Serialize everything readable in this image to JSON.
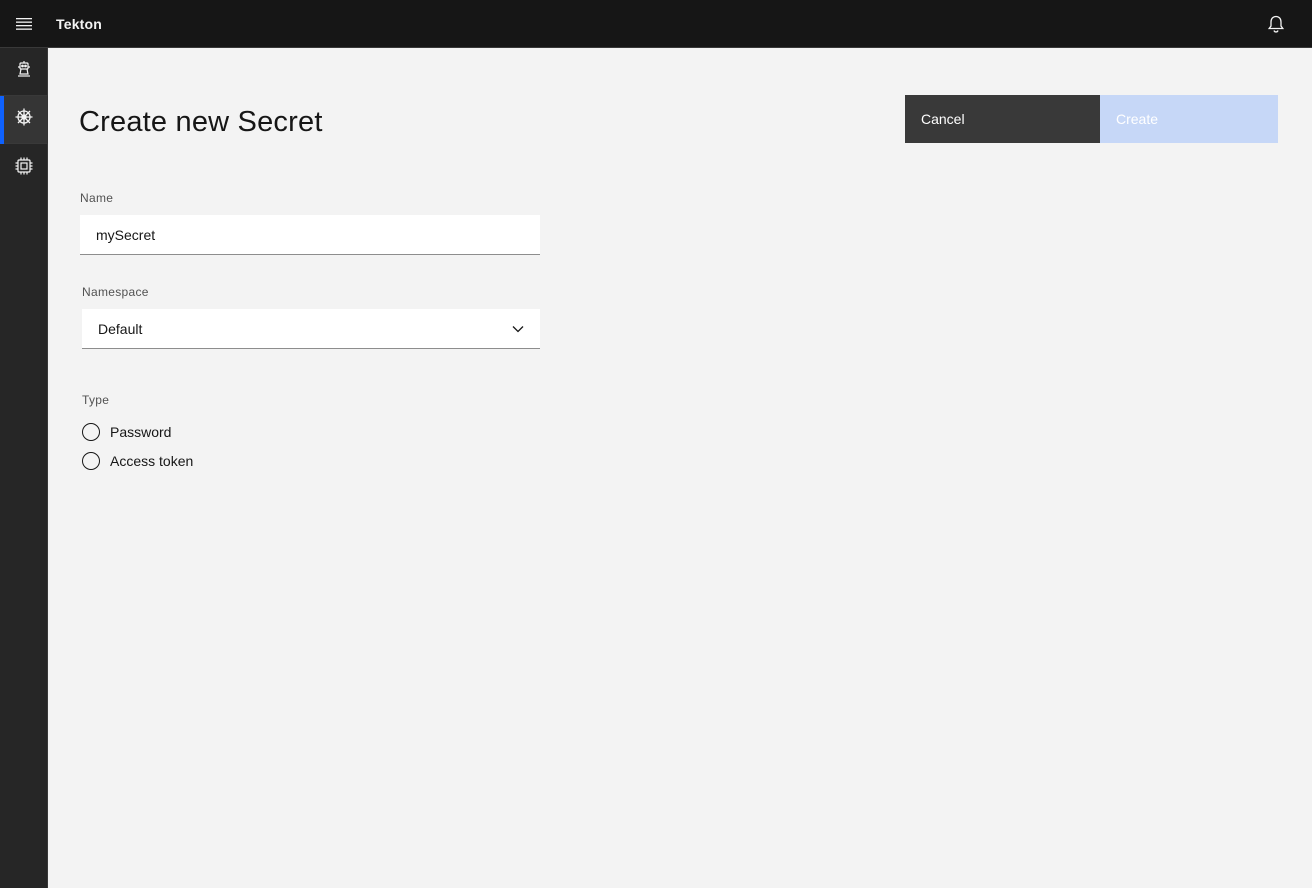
{
  "header": {
    "app_title": "Tekton",
    "menu_icon": "hamburger-menu-icon",
    "notification_icon": "bell-icon"
  },
  "sidenav": {
    "items": [
      {
        "icon": "robot-icon",
        "active": false
      },
      {
        "icon": "helm-wheel-icon",
        "active": true
      },
      {
        "icon": "chip-icon",
        "active": false
      }
    ]
  },
  "page": {
    "title": "Create new Secret"
  },
  "actions": {
    "cancel_label": "Cancel",
    "create_label": "Create"
  },
  "form": {
    "name": {
      "label": "Name",
      "value": "mySecret"
    },
    "namespace": {
      "label": "Namespace",
      "selected": "Default"
    },
    "type": {
      "label": "Type",
      "options": [
        "Password",
        "Access token"
      ]
    }
  },
  "colors": {
    "header_bg": "#161616",
    "sidenav_bg": "#262626",
    "accent": "#0f62fe",
    "cancel_bg": "#393939",
    "create_disabled_bg": "#c6d7f7",
    "page_bg": "#f3f3f3"
  }
}
